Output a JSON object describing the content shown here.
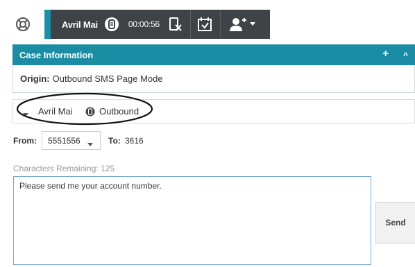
{
  "toolbar": {
    "party_name": "Avril Mai",
    "timer": "00:00:56"
  },
  "case": {
    "title": "Case Information",
    "add_label": "+",
    "collapse_label": "^",
    "origin_label": "Origin:",
    "origin_value": "Outbound SMS Page Mode"
  },
  "interaction": {
    "party_name": "Avril Mai",
    "direction": "Outbound"
  },
  "message": {
    "from_label": "From:",
    "from_value": "5551556",
    "to_label": "To:",
    "to_value": "3616",
    "chars_remaining": "Characters Remaining: 125",
    "text": "Please send me your account number.",
    "send_label": "Send"
  },
  "colors": {
    "toolbar_bg": "#3f4347",
    "accent": "#1a8ca4",
    "annotation": "#111111"
  },
  "icons": [
    "global-channel-icon",
    "sms-icon",
    "end-chat-icon",
    "schedule-icon",
    "party-icon",
    "collapse-icon",
    "sms-channel-icon"
  ]
}
